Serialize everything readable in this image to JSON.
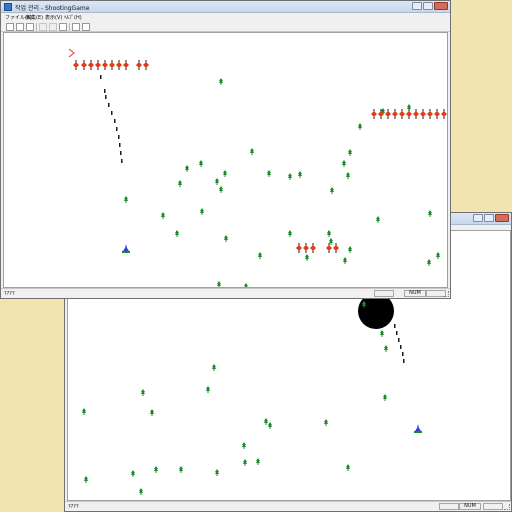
{
  "front_window": {
    "title": "작업 관리 - ShootingGame",
    "menu": [
      "ファイル(F)",
      "編集(E)",
      "表示(V)",
      "ﾍﾙﾌﾟ(H)"
    ],
    "status_left": "????",
    "status_num": "NUM"
  },
  "back_window": {
    "status_left": "????",
    "status_num": "NUM"
  },
  "colors": {
    "bullet": "#1a1a1a",
    "enemy": "#e23b1b",
    "tree": "#1c8a2c",
    "player": "#3b3bd4"
  },
  "game": {
    "sprites": [
      "tree-sprite",
      "enemy-sprite",
      "player-ship-sprite",
      "bullet-trail",
      "black-blob"
    ]
  }
}
